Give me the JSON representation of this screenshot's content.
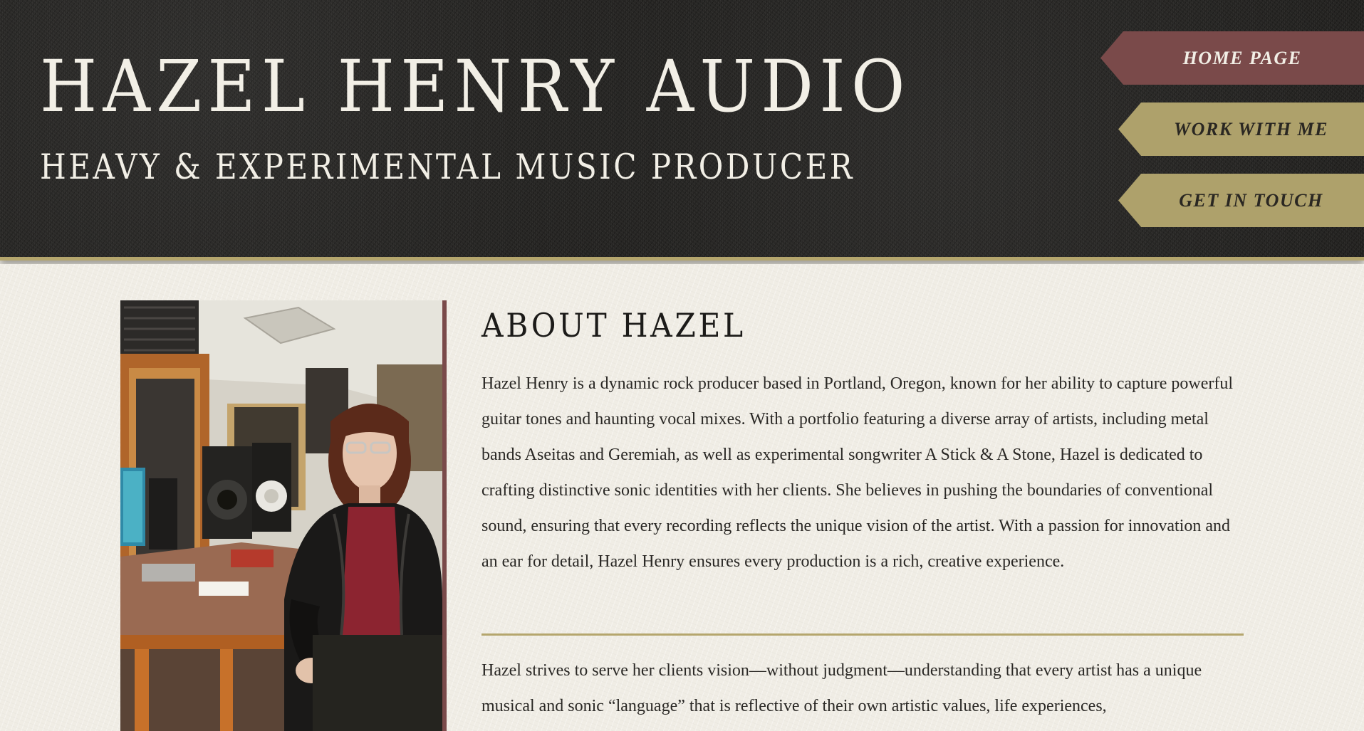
{
  "header": {
    "title": "HAZEL HENRY AUDIO",
    "subtitle": "HEAVY & EXPERIMENTAL MUSIC PRODUCER"
  },
  "nav": {
    "items": [
      {
        "label": "HOME PAGE",
        "active": true
      },
      {
        "label": "WORK WITH ME",
        "active": false
      },
      {
        "label": "GET IN TOUCH",
        "active": false
      }
    ]
  },
  "about": {
    "heading": "ABOUT HAZEL",
    "paragraph1": "Hazel Henry is a dynamic rock producer based in Portland, Oregon, known for her ability to capture powerful guitar tones and haunting vocal mixes. With a portfolio featuring a diverse array of artists, including metal bands Aseitas and Geremiah, as well as experimental songwriter A Stick & A Stone, Hazel is dedicated to crafting distinctive sonic identities with her clients. She believes in pushing the boundaries of conventional sound, ensuring that every recording reflects the unique vision of the artist. With a passion for innovation and an ear for detail, Hazel Henry ensures every production is a rich, creative experience.",
    "paragraph2": "Hazel strives to serve her clients vision—without judgment—understanding that every artist has a unique musical and sonic “language” that is reflective of their own artistic values, life experiences,"
  },
  "colors": {
    "header_bg": "#232220",
    "accent_gold": "#aea16b",
    "accent_maroon": "#7a4a4a",
    "page_bg": "#f0ede5",
    "text_light": "#f2efe6",
    "text_dark": "#2a2825"
  }
}
